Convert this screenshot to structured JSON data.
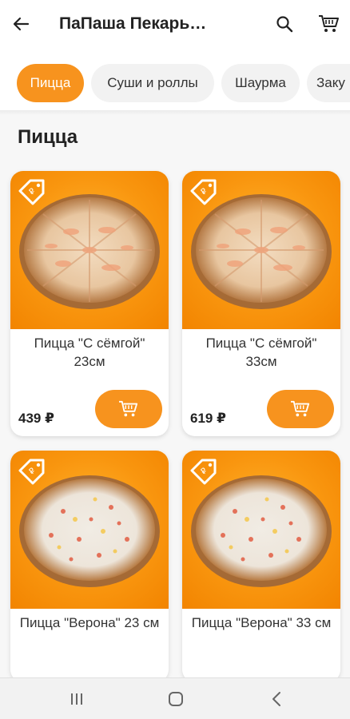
{
  "header": {
    "title": "ПаПаша Пекарь…",
    "back_icon": "arrow-left-icon",
    "search_icon": "search-icon",
    "cart_icon": "cart-icon"
  },
  "categories": [
    {
      "label": "Пицца",
      "active": true
    },
    {
      "label": "Суши и роллы",
      "active": false
    },
    {
      "label": "Шаурма",
      "active": false
    },
    {
      "label": "Заку",
      "active": false
    }
  ],
  "section": {
    "title": "Пицца"
  },
  "products": [
    {
      "name": "Пицца \"С сёмгой\" 23см",
      "price": "439 ₽",
      "pizza": "salmon"
    },
    {
      "name": "Пицца \"С сёмгой\" 33см",
      "price": "619 ₽",
      "pizza": "salmon"
    },
    {
      "name": "Пицца \"Верона\" 23 см",
      "price": "",
      "pizza": "verona"
    },
    {
      "name": "Пицца \"Верона\" 33 см",
      "price": "",
      "pizza": "verona"
    }
  ],
  "colors": {
    "accent": "#f7931e",
    "chip_bg": "#f2f2f2"
  },
  "system_nav": {
    "recent_icon": "recent-apps-icon",
    "home_icon": "home-icon",
    "back_icon": "back-chevron-icon"
  }
}
